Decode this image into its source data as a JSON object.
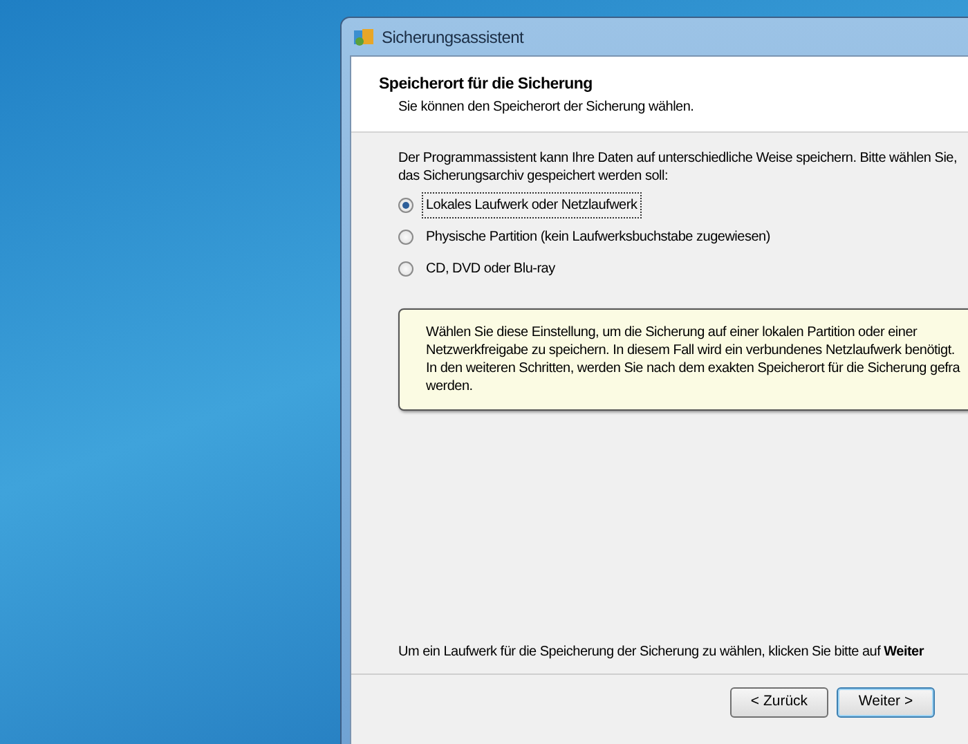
{
  "window": {
    "title": "Sicherungsassistent"
  },
  "header": {
    "title": "Speicherort für die Sicherung",
    "subtitle": "Sie können den Speicherort der Sicherung wählen."
  },
  "intro": [
    "Der Programmassistent kann Ihre Daten auf unterschiedliche Weise speichern. Bitte wählen Sie,",
    "das Sicherungsarchiv gespeichert werden soll:"
  ],
  "options": [
    {
      "label": "Lokales Laufwerk oder Netzlaufwerk",
      "selected": true
    },
    {
      "label": "Physische Partition (kein Laufwerksbuchstabe zugewiesen)",
      "selected": false
    },
    {
      "label": "CD, DVD oder Blu-ray",
      "selected": false
    }
  ],
  "description": [
    "Wählen Sie diese Einstellung, um die Sicherung auf einer lokalen Partition oder einer",
    "Netzwerkfreigabe zu speichern. In diesem Fall wird ein verbundenes Netzlaufwerk benötigt.",
    "In den weiteren Schritten, werden Sie nach dem exakten Speicherort für die Sicherung gefra",
    "werden."
  ],
  "hint": "Um ein Laufwerk für die Speicherung der Sicherung zu wählen, klicken Sie bitte auf **Weiter**",
  "buttons": [
    {
      "label": "< Zurück",
      "selected": false
    },
    {
      "label": "Weiter >",
      "selected": true
    }
  ]
}
